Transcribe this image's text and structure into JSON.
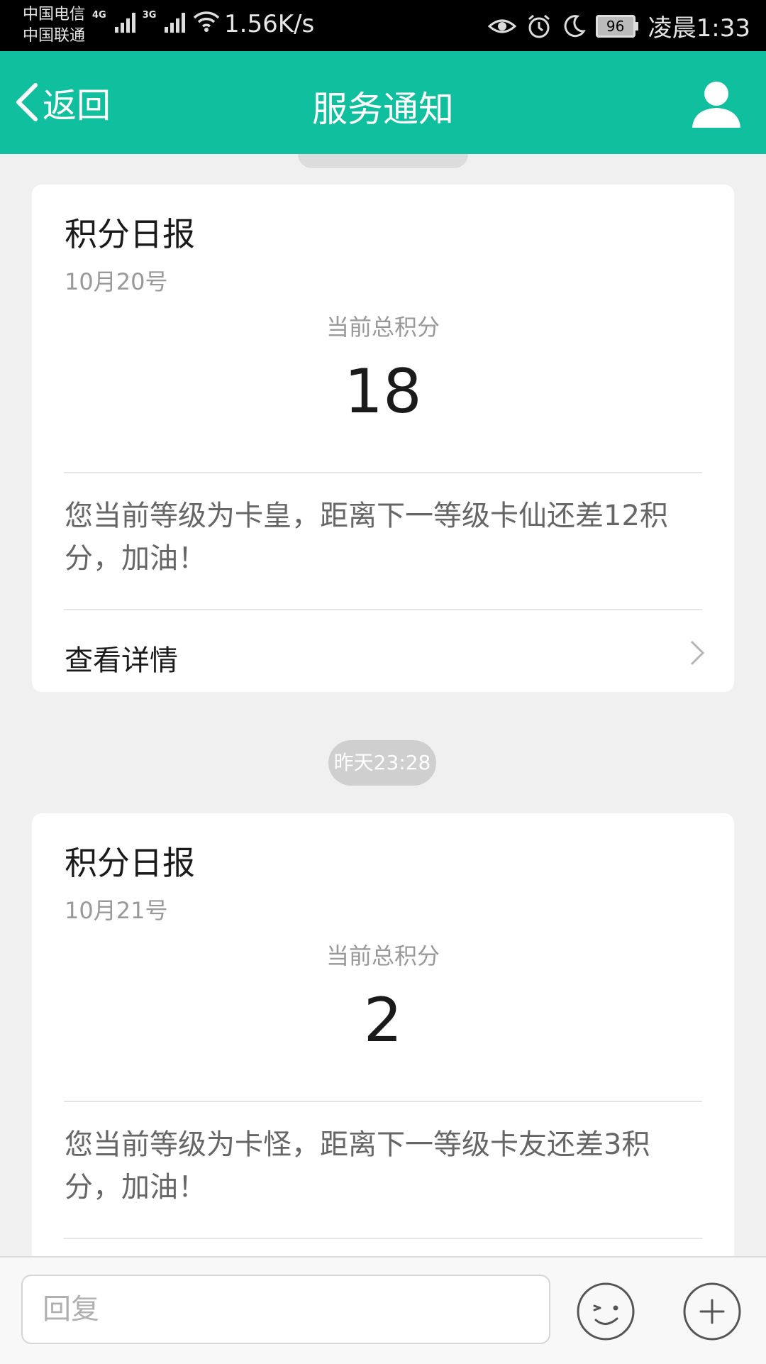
{
  "status_bar": {
    "carrier_1": "中国电信",
    "carrier_2": "中国联通",
    "net_1": "4G",
    "net_2": "3G",
    "speed": "1.56K/s",
    "battery": "96",
    "time": "凌晨1:33",
    "icons": [
      "signal-icon",
      "wifi-icon",
      "eye-icon",
      "alarm-icon",
      "moon-icon",
      "battery-icon"
    ]
  },
  "header": {
    "back_label": "返回",
    "title": "服务通知",
    "bg_color": "#0fbf9e"
  },
  "messages": [
    {
      "title": "积分日报",
      "date": "10月20号",
      "score_label": "当前总积分",
      "score": "18",
      "message": "您当前等级为卡皇，距离下一等级卡仙还差12积分，加油！",
      "link": "查看详情"
    },
    {
      "timestamp": "昨天23:28",
      "title": "积分日报",
      "date": "10月21号",
      "score_label": "当前总积分",
      "score": "2",
      "message": "您当前等级为卡怪，距离下一等级卡友还差3积分，加油！"
    }
  ],
  "reply": {
    "placeholder": "回复"
  }
}
